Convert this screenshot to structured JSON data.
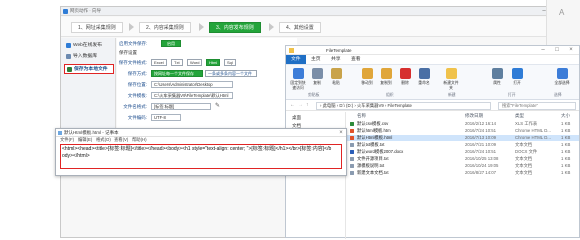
{
  "app": {
    "title": "网页动作 · 向导",
    "controls": [
      "–",
      "□",
      "×"
    ]
  },
  "steps": [
    {
      "label": "1、网址采集规则",
      "active": false
    },
    {
      "label": "2、内容采集规则",
      "active": false
    },
    {
      "label": "3、内容发布规则",
      "active": true
    },
    {
      "label": "4、其他设置",
      "active": false
    }
  ],
  "sidebar": {
    "items": [
      {
        "label": "Web在线发布",
        "selected": false
      },
      {
        "label": "导入数据库",
        "selected": false
      },
      {
        "label": "保存为本地文件",
        "selected": true
      }
    ]
  },
  "form": {
    "enable_label": "启用文件保存:",
    "enable_value": "启用",
    "section_title": "保存设置",
    "format_label": "保存文件格式:",
    "formats": [
      "Excel",
      "Txt",
      "Word",
      "Html",
      "Sql"
    ],
    "format_selected": "Html",
    "template_label": "保存方式:",
    "template_value": "按网址每一个文件保存",
    "template_alt": "一条或多条内容一个文件",
    "path_label": "保存位置:",
    "path_value": "C:\\Users\\Administrator\\Desktop",
    "template_file_label": "文件模板:",
    "template_file_value": "C:\\火车采集器V9\\FileTemplate\\默认Html",
    "template_btn": "查看默认模板",
    "filename_label": "文件名格式:",
    "filename_value": "[标签:标题]",
    "encoding_label": "文件编码:",
    "encoding_value": "UTF-8"
  },
  "explorer": {
    "title": "FileTemplate",
    "tabs": [
      "文件",
      "主页",
      "共享",
      "查看"
    ],
    "ribbon_buttons": [
      "固定到快速访问",
      "复制",
      "粘贴",
      "移动到",
      "复制到",
      "删除",
      "重命名",
      "新建文件夹",
      "属性",
      "打开",
      "全部选择"
    ],
    "groups": [
      "剪贴板",
      "组织",
      "新建",
      "打开",
      "选择"
    ],
    "path": "› 此电脑 › D:\\ (D:) › 火车采集器V9 › FileTemplate",
    "search_placeholder": "搜索\"FileTemplate\"",
    "nav": [
      "桌面",
      "文档"
    ],
    "columns": [
      "名称",
      "修改日期",
      "类型",
      "大小"
    ],
    "files": [
      {
        "name": "默认csv模板.csv",
        "date": "2016/2/12 16:14",
        "type": "XLS 工作表",
        "size": "1 KB",
        "icon": "#2e8b3a",
        "sel": false
      },
      {
        "name": "默认html模板.htm",
        "date": "2016/7/24 10:51",
        "type": "Chrome HTML D...",
        "size": "1 KB",
        "icon": "#e0512a",
        "sel": false
      },
      {
        "name": "默认Html模板.html",
        "date": "2016/7/13 10:09",
        "type": "Chrome HTML D...",
        "size": "1 KB",
        "icon": "#e0512a",
        "sel": true
      },
      {
        "name": "默认txt模板.txt",
        "date": "2016/7/21 10:09",
        "type": "文本文档",
        "size": "1 KB",
        "icon": "#8a9bb0",
        "sel": false
      },
      {
        "name": "默认word模板2007.docx",
        "date": "2016/7/24 10:51",
        "type": "DOCX 文件",
        "size": "1 KB",
        "icon": "#2b5eb8",
        "sel": false
      },
      {
        "name": "文件开源项目.txt",
        "date": "2016/10/25 13:08",
        "type": "文本文档",
        "size": "1 KB",
        "icon": "#8a9bb0",
        "sel": false
      },
      {
        "name": "源模板说明.txt",
        "date": "2016/10/24 19:05",
        "type": "文本文档",
        "size": "1 KB",
        "icon": "#8a9bb0",
        "sel": false
      },
      {
        "name": "新建文本文档.txt",
        "date": "2016/8/27 14:07",
        "type": "文本文档",
        "size": "1 KB",
        "icon": "#8a9bb0",
        "sel": false
      }
    ]
  },
  "notepad": {
    "title": "默认Html模板.html - 记事本",
    "menu": [
      "文件(F)",
      "编辑(E)",
      "格式(O)",
      "查看(V)",
      "帮助(H)"
    ],
    "content": "<html><head><title>[标签:标题]</title></head><body><h1 style=\"text-align: center; \">[标签:标题]</h1></br>[标签:内容]</body></html>"
  }
}
